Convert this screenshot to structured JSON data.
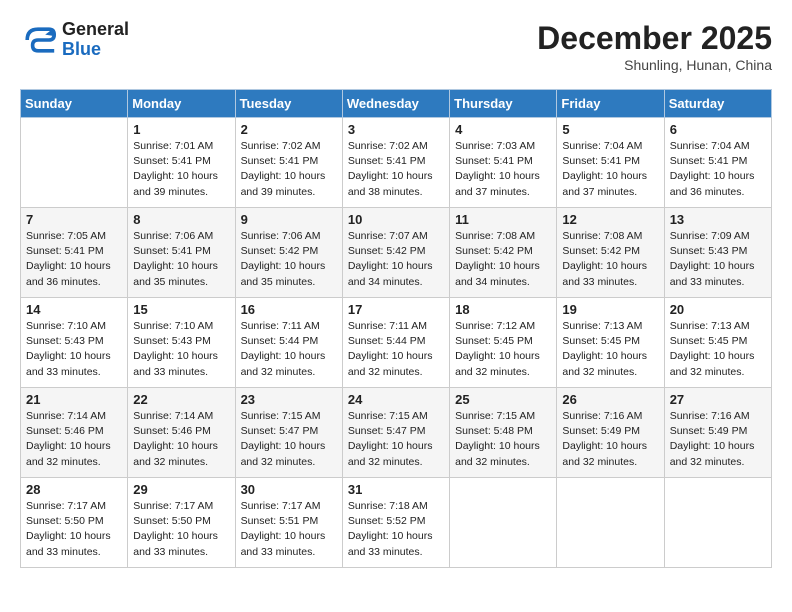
{
  "header": {
    "logo_general": "General",
    "logo_blue": "Blue",
    "month": "December 2025",
    "location": "Shunling, Hunan, China"
  },
  "weekdays": [
    "Sunday",
    "Monday",
    "Tuesday",
    "Wednesday",
    "Thursday",
    "Friday",
    "Saturday"
  ],
  "weeks": [
    [
      {
        "day": "",
        "info": ""
      },
      {
        "day": "1",
        "info": "Sunrise: 7:01 AM\nSunset: 5:41 PM\nDaylight: 10 hours\nand 39 minutes."
      },
      {
        "day": "2",
        "info": "Sunrise: 7:02 AM\nSunset: 5:41 PM\nDaylight: 10 hours\nand 39 minutes."
      },
      {
        "day": "3",
        "info": "Sunrise: 7:02 AM\nSunset: 5:41 PM\nDaylight: 10 hours\nand 38 minutes."
      },
      {
        "day": "4",
        "info": "Sunrise: 7:03 AM\nSunset: 5:41 PM\nDaylight: 10 hours\nand 37 minutes."
      },
      {
        "day": "5",
        "info": "Sunrise: 7:04 AM\nSunset: 5:41 PM\nDaylight: 10 hours\nand 37 minutes."
      },
      {
        "day": "6",
        "info": "Sunrise: 7:04 AM\nSunset: 5:41 PM\nDaylight: 10 hours\nand 36 minutes."
      }
    ],
    [
      {
        "day": "7",
        "info": "Sunrise: 7:05 AM\nSunset: 5:41 PM\nDaylight: 10 hours\nand 36 minutes."
      },
      {
        "day": "8",
        "info": "Sunrise: 7:06 AM\nSunset: 5:41 PM\nDaylight: 10 hours\nand 35 minutes."
      },
      {
        "day": "9",
        "info": "Sunrise: 7:06 AM\nSunset: 5:42 PM\nDaylight: 10 hours\nand 35 minutes."
      },
      {
        "day": "10",
        "info": "Sunrise: 7:07 AM\nSunset: 5:42 PM\nDaylight: 10 hours\nand 34 minutes."
      },
      {
        "day": "11",
        "info": "Sunrise: 7:08 AM\nSunset: 5:42 PM\nDaylight: 10 hours\nand 34 minutes."
      },
      {
        "day": "12",
        "info": "Sunrise: 7:08 AM\nSunset: 5:42 PM\nDaylight: 10 hours\nand 33 minutes."
      },
      {
        "day": "13",
        "info": "Sunrise: 7:09 AM\nSunset: 5:43 PM\nDaylight: 10 hours\nand 33 minutes."
      }
    ],
    [
      {
        "day": "14",
        "info": "Sunrise: 7:10 AM\nSunset: 5:43 PM\nDaylight: 10 hours\nand 33 minutes."
      },
      {
        "day": "15",
        "info": "Sunrise: 7:10 AM\nSunset: 5:43 PM\nDaylight: 10 hours\nand 33 minutes."
      },
      {
        "day": "16",
        "info": "Sunrise: 7:11 AM\nSunset: 5:44 PM\nDaylight: 10 hours\nand 32 minutes."
      },
      {
        "day": "17",
        "info": "Sunrise: 7:11 AM\nSunset: 5:44 PM\nDaylight: 10 hours\nand 32 minutes."
      },
      {
        "day": "18",
        "info": "Sunrise: 7:12 AM\nSunset: 5:45 PM\nDaylight: 10 hours\nand 32 minutes."
      },
      {
        "day": "19",
        "info": "Sunrise: 7:13 AM\nSunset: 5:45 PM\nDaylight: 10 hours\nand 32 minutes."
      },
      {
        "day": "20",
        "info": "Sunrise: 7:13 AM\nSunset: 5:45 PM\nDaylight: 10 hours\nand 32 minutes."
      }
    ],
    [
      {
        "day": "21",
        "info": "Sunrise: 7:14 AM\nSunset: 5:46 PM\nDaylight: 10 hours\nand 32 minutes."
      },
      {
        "day": "22",
        "info": "Sunrise: 7:14 AM\nSunset: 5:46 PM\nDaylight: 10 hours\nand 32 minutes."
      },
      {
        "day": "23",
        "info": "Sunrise: 7:15 AM\nSunset: 5:47 PM\nDaylight: 10 hours\nand 32 minutes."
      },
      {
        "day": "24",
        "info": "Sunrise: 7:15 AM\nSunset: 5:47 PM\nDaylight: 10 hours\nand 32 minutes."
      },
      {
        "day": "25",
        "info": "Sunrise: 7:15 AM\nSunset: 5:48 PM\nDaylight: 10 hours\nand 32 minutes."
      },
      {
        "day": "26",
        "info": "Sunrise: 7:16 AM\nSunset: 5:49 PM\nDaylight: 10 hours\nand 32 minutes."
      },
      {
        "day": "27",
        "info": "Sunrise: 7:16 AM\nSunset: 5:49 PM\nDaylight: 10 hours\nand 32 minutes."
      }
    ],
    [
      {
        "day": "28",
        "info": "Sunrise: 7:17 AM\nSunset: 5:50 PM\nDaylight: 10 hours\nand 33 minutes."
      },
      {
        "day": "29",
        "info": "Sunrise: 7:17 AM\nSunset: 5:50 PM\nDaylight: 10 hours\nand 33 minutes."
      },
      {
        "day": "30",
        "info": "Sunrise: 7:17 AM\nSunset: 5:51 PM\nDaylight: 10 hours\nand 33 minutes."
      },
      {
        "day": "31",
        "info": "Sunrise: 7:18 AM\nSunset: 5:52 PM\nDaylight: 10 hours\nand 33 minutes."
      },
      {
        "day": "",
        "info": ""
      },
      {
        "day": "",
        "info": ""
      },
      {
        "day": "",
        "info": ""
      }
    ]
  ]
}
